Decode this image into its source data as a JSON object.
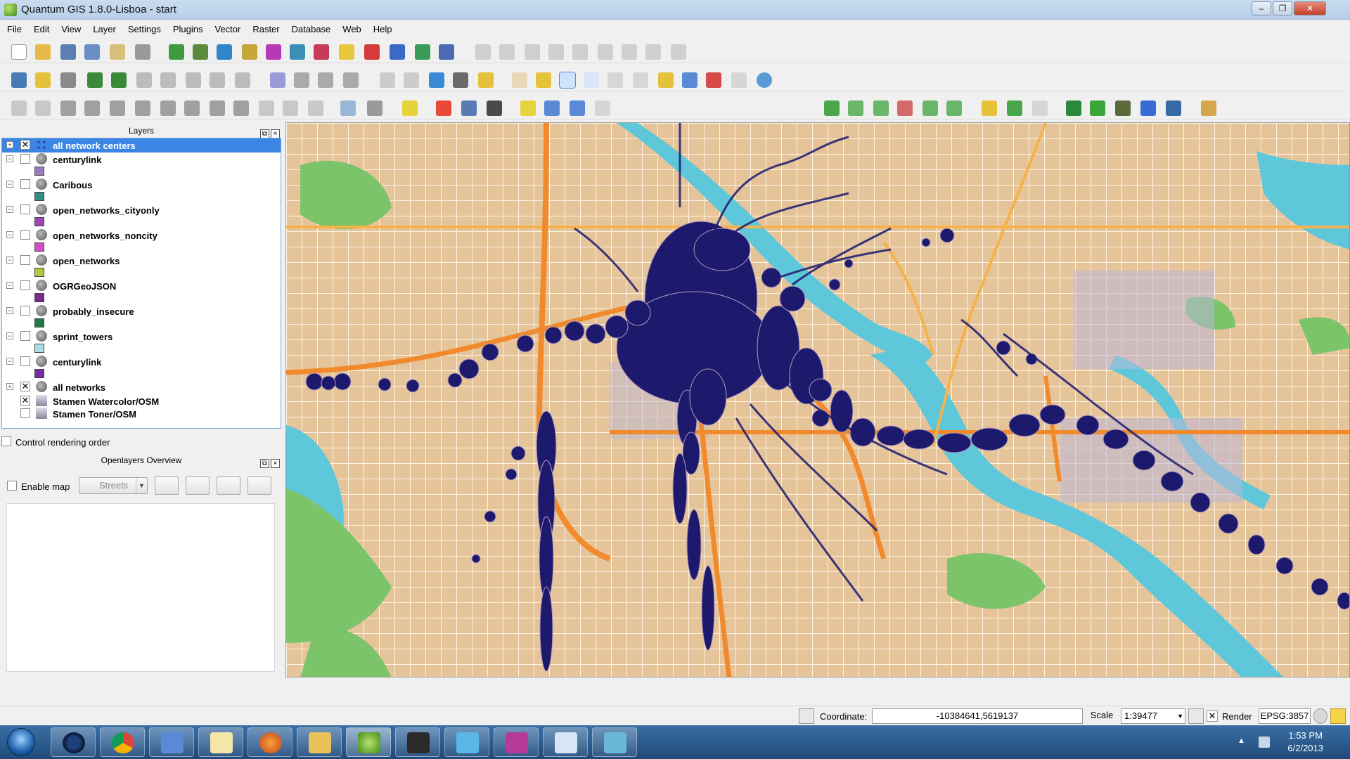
{
  "window": {
    "title": "Quantum GIS 1.8.0-Lisboa - start",
    "minimize": "–",
    "maximize": "❐",
    "close": "✕"
  },
  "menu": [
    "File",
    "Edit",
    "View",
    "Layer",
    "Settings",
    "Plugins",
    "Vector",
    "Raster",
    "Database",
    "Web",
    "Help"
  ],
  "layers_panel": {
    "title": "Layers",
    "layers": [
      {
        "name": "all network centers",
        "checked": "✕",
        "expander": "+",
        "selected": true,
        "swatch": ""
      },
      {
        "name": "centurylink",
        "checked": "",
        "expander": "−",
        "swatch": "#9b7bbf"
      },
      {
        "name": "Caribous",
        "checked": "",
        "expander": "−",
        "swatch": "#2f8f84"
      },
      {
        "name": "open_networks_cityonly",
        "checked": "",
        "expander": "−",
        "swatch": "#a445b8"
      },
      {
        "name": "open_networks_noncity",
        "checked": "",
        "expander": "−",
        "swatch": "#d04fc3"
      },
      {
        "name": "open_networks",
        "checked": "",
        "expander": "−",
        "swatch": "#b7c63a"
      },
      {
        "name": "OGRGeoJSON",
        "checked": "",
        "expander": "−",
        "swatch": "#7a2a8a"
      },
      {
        "name": "probably_insecure",
        "checked": "",
        "expander": "−",
        "swatch": "#1f7a45"
      },
      {
        "name": "sprint_towers",
        "checked": "",
        "expander": "−",
        "swatch": "#a8dde6"
      },
      {
        "name": "centurylink",
        "checked": "",
        "expander": "−",
        "swatch": "#7a2aa8"
      },
      {
        "name": "all networks",
        "checked": "✕",
        "expander": "+",
        "swatch": ""
      },
      {
        "name": "Stamen Watercolor/OSM",
        "checked": "✕",
        "expander": "",
        "raster": true,
        "swatch": ""
      },
      {
        "name": "Stamen Toner/OSM",
        "checked": "",
        "expander": "",
        "raster": true,
        "swatch": ""
      }
    ]
  },
  "control_rendering_order": "Control rendering order",
  "overview_panel": {
    "title": "Openlayers Overview",
    "enable_map": "Enable map",
    "streets": "Streets"
  },
  "statusbar": {
    "coordinate_label": "Coordinate:",
    "coordinate_value": "-10384641,5619137",
    "scale_label": "Scale",
    "scale_value": "1:39477",
    "render_label": "Render",
    "render_checked": "✕",
    "crs": "EPSG:3857"
  },
  "taskbar": {
    "time": "1:53 PM",
    "date": "6/2/2013"
  },
  "colors": {
    "selection": "#3b86e4",
    "network_points": "#1d1a6e",
    "map_land": "#e8caa4",
    "water": "#5ec7d9",
    "parks": "#7cc46a",
    "highways": "#f08a2c"
  }
}
